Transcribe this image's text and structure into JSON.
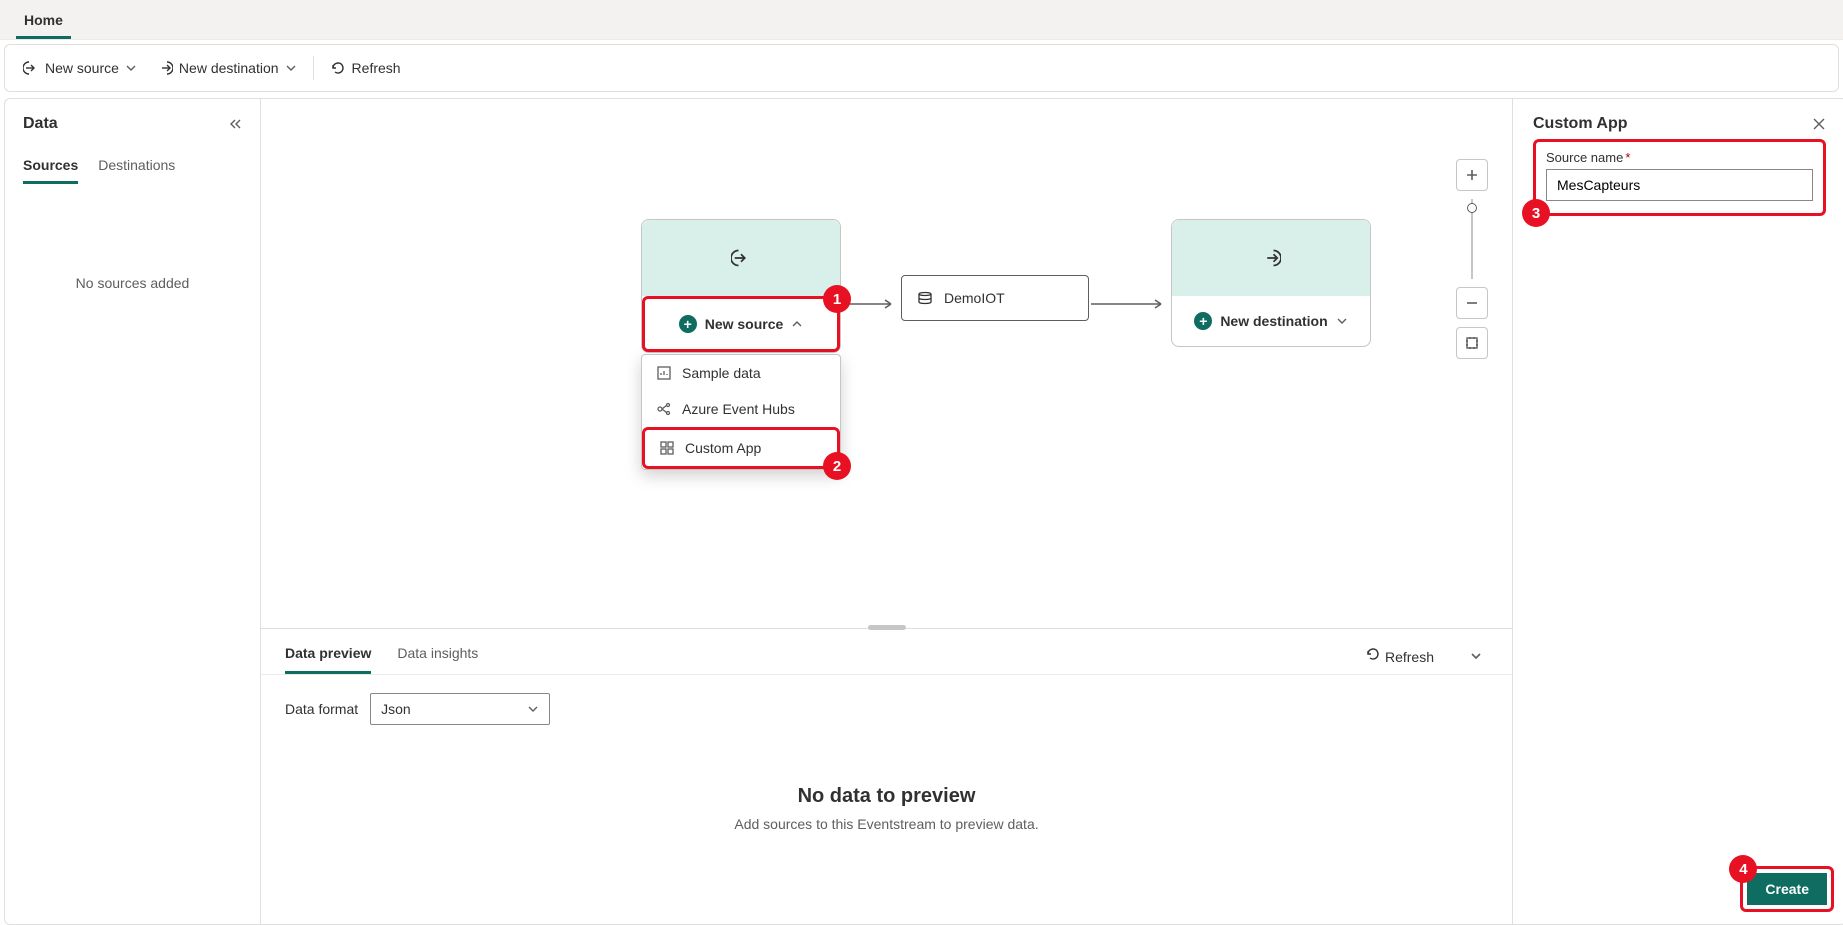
{
  "topTabs": {
    "home": "Home"
  },
  "toolbar": {
    "newSource": "New source",
    "newDestination": "New destination",
    "refresh": "Refresh"
  },
  "left": {
    "title": "Data",
    "tabs": {
      "sources": "Sources",
      "destinations": "Destinations"
    },
    "emptyMsg": "No sources added"
  },
  "canvas": {
    "newSource": "New source",
    "newDestination": "New destination",
    "centerNode": "DemoIOT",
    "sourceMenu": {
      "sample": "Sample data",
      "eventHubs": "Azure Event Hubs",
      "customApp": "Custom App"
    }
  },
  "callouts": {
    "c1": "1",
    "c2": "2",
    "c3": "3",
    "c4": "4"
  },
  "preview": {
    "tabs": {
      "data": "Data preview",
      "insights": "Data insights"
    },
    "refresh": "Refresh",
    "dataFormatLabel": "Data format",
    "dataFormatValue": "Json",
    "emptyTitle": "No data to preview",
    "emptySub": "Add sources to this Eventstream to preview data."
  },
  "right": {
    "title": "Custom App",
    "sourceNameLabel": "Source name",
    "sourceNameValue": "MesCapteurs",
    "create": "Create"
  }
}
